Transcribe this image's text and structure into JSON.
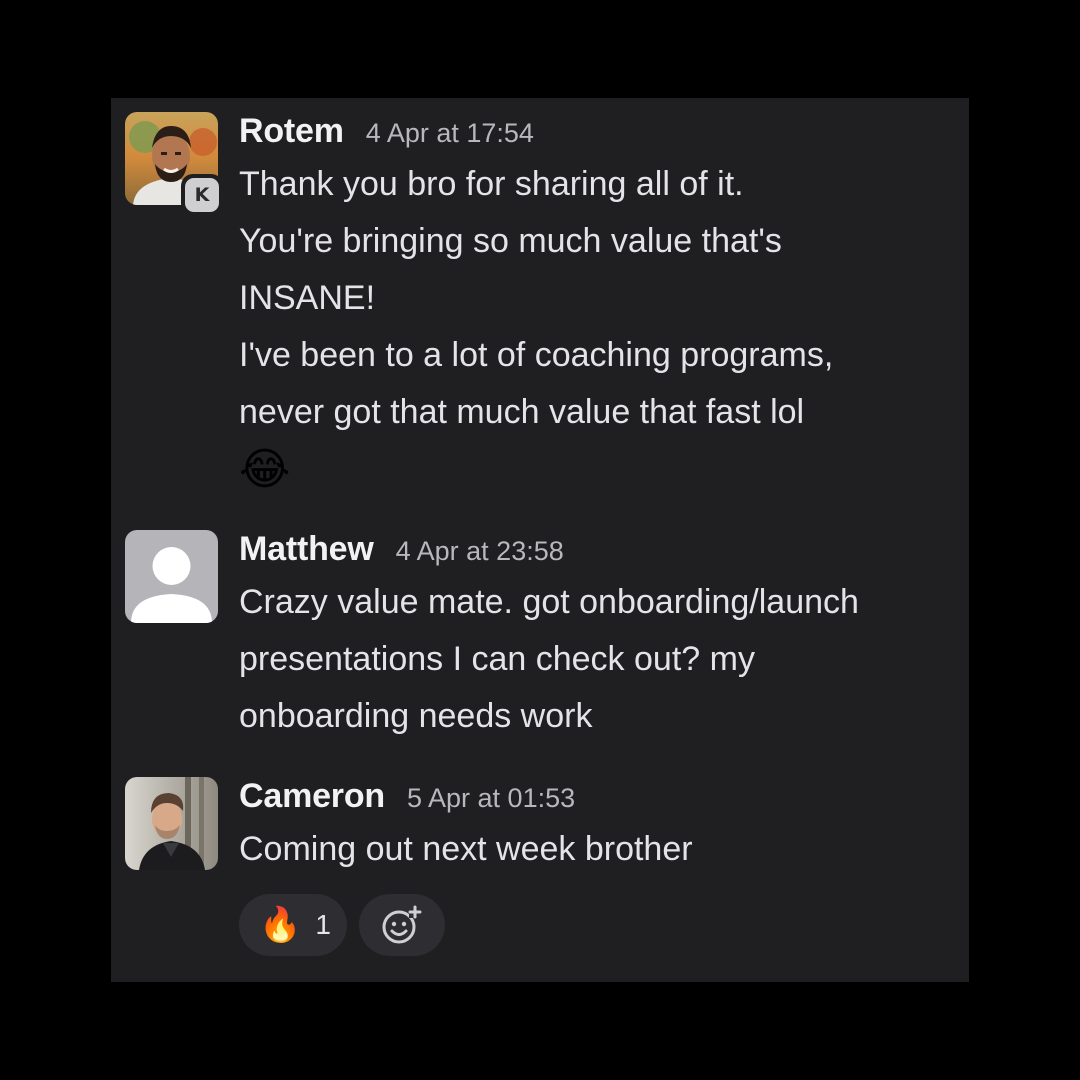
{
  "messages": [
    {
      "author": "Rotem",
      "timestamp": "4 Apr at 17:54",
      "badge": "K",
      "lines": [
        "Thank you bro for sharing all of it.",
        "You're bringing so much value that's",
        "INSANE!",
        "I've been to a lot of coaching programs,",
        "never got that much value that fast lol"
      ],
      "emoji": "😂"
    },
    {
      "author": "Matthew",
      "timestamp": "4 Apr at 23:58",
      "lines": [
        "Crazy value mate. got onboarding/launch",
        "presentations I can check out? my",
        "onboarding needs work"
      ]
    },
    {
      "author": "Cameron",
      "timestamp": "5 Apr at 01:53",
      "lines": [
        "Coming out next week brother"
      ],
      "reactions": [
        {
          "emoji": "🔥",
          "count": "1",
          "icon": "fire-icon"
        }
      ],
      "add_reaction_icon": "add-reaction-icon"
    }
  ],
  "colors": {
    "page_background": "#000000",
    "panel_background": "#1f1f22",
    "name_text": "#f2f2f4",
    "message_text": "#e4e4e8",
    "timestamp_text": "#b7b7bc",
    "reaction_background": "#2e2e32"
  }
}
